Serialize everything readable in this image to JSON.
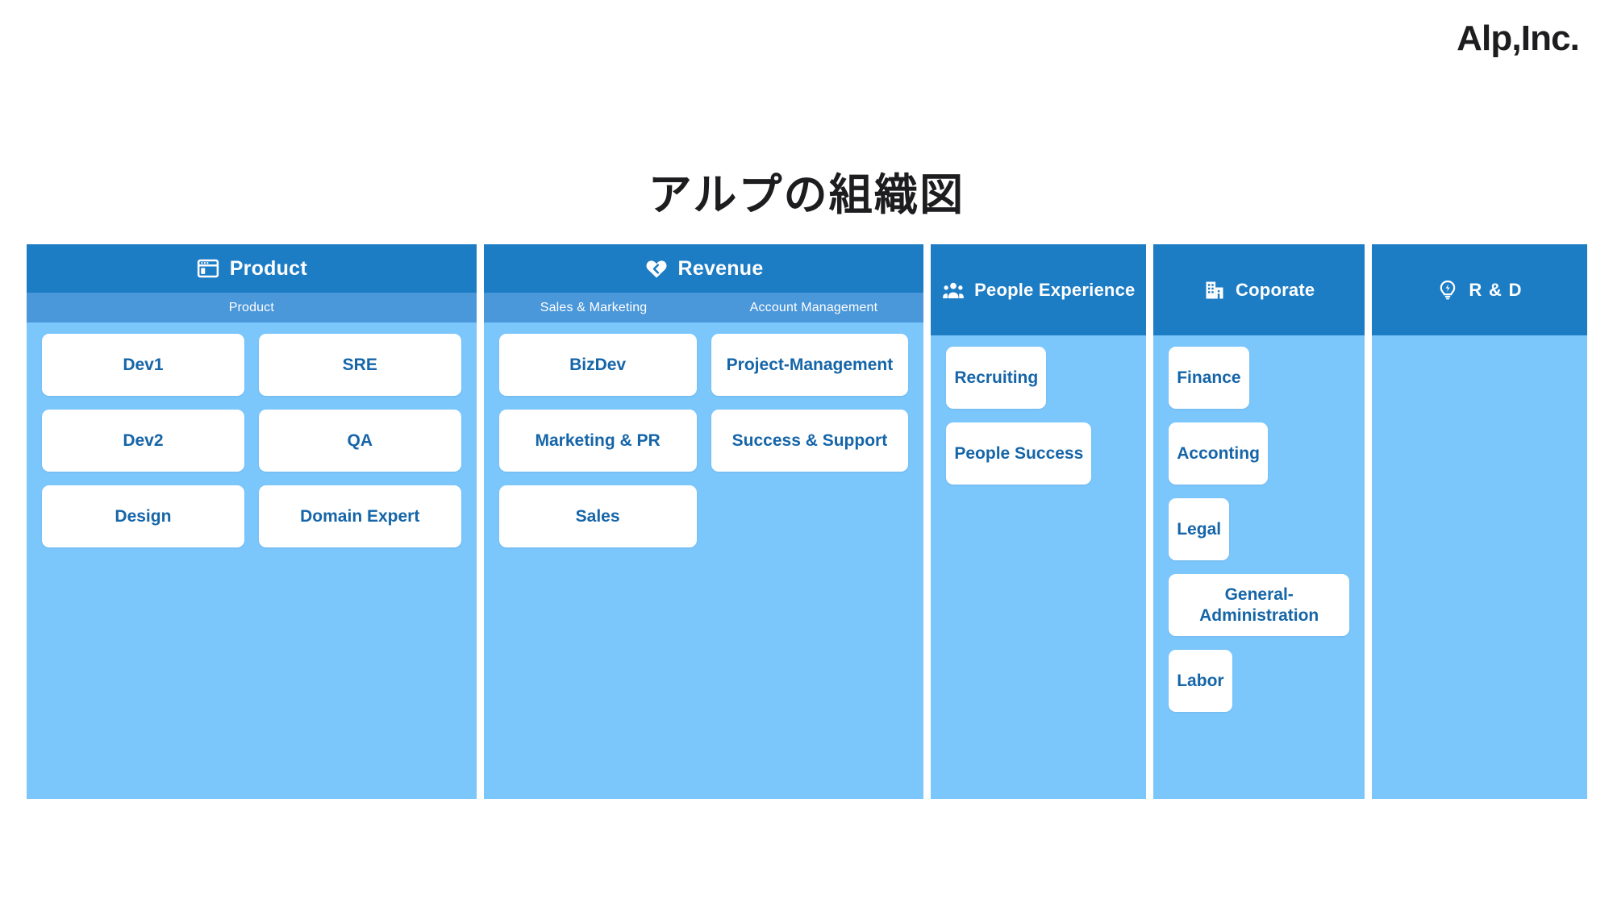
{
  "logo": {
    "text": "Alp,Inc."
  },
  "title": "アルプの組織図",
  "colors": {
    "header_blue": "#1C7CC4",
    "subband_blue": "#4A97DA",
    "body_blue": "#7BC6FB",
    "card_bg": "#FFFFFF",
    "card_text": "#1565A8",
    "page_bg": "#FFFFFF",
    "title_text": "#1D1D1F"
  },
  "chart_data": {
    "type": "table",
    "title": "アルプの組織図",
    "columns": [
      {
        "label": "Product",
        "icon": "browser-window-icon",
        "subgroups": [
          {
            "label": "Product",
            "teams": [
              "Dev1",
              "Dev2",
              "Design"
            ]
          },
          {
            "label": "",
            "teams": [
              "SRE",
              "QA",
              "Domain Expert"
            ]
          }
        ]
      },
      {
        "label": "Revenue",
        "icon": "heart-icon",
        "subgroups": [
          {
            "label": "Sales & Marketing",
            "teams": [
              "BizDev",
              "Marketing & PR",
              "Sales"
            ]
          },
          {
            "label": "Account Management",
            "teams": [
              "Project-Management",
              "Success & Support"
            ]
          }
        ]
      },
      {
        "label": "People Experience",
        "icon": "people-group-icon",
        "subgroups": [
          {
            "label": "",
            "teams": [
              "Recruiting",
              "People Success"
            ]
          }
        ]
      },
      {
        "label": "Coporate",
        "icon": "building-icon",
        "subgroups": [
          {
            "label": "",
            "teams": [
              "Finance",
              "Acconting",
              "Legal",
              "General-Administration",
              "Labor"
            ]
          }
        ]
      },
      {
        "label": "R & D",
        "icon": "lightbulb-bolt-icon",
        "subgroups": [
          {
            "label": "",
            "teams": []
          }
        ]
      }
    ]
  },
  "columns": {
    "product": {
      "header": "Product",
      "subband": {
        "left": "Product"
      },
      "cards": {
        "left": [
          "Dev1",
          "Dev2",
          "Design"
        ],
        "right": [
          "SRE",
          "QA",
          "Domain Expert"
        ]
      }
    },
    "revenue": {
      "header": "Revenue",
      "subband": {
        "left": "Sales & Marketing",
        "right": "Account Management"
      },
      "cards": {
        "left": [
          "BizDev",
          "Marketing & PR",
          "Sales"
        ],
        "right": [
          "Project-Management",
          "Success & Support"
        ]
      }
    },
    "people": {
      "header": "People Experience",
      "cards": [
        "Recruiting",
        "People Success"
      ]
    },
    "corporate": {
      "header": "Coporate",
      "cards": [
        "Finance",
        "Acconting",
        "Legal",
        "General-Administration",
        "Labor"
      ]
    },
    "rd": {
      "header": "R & D",
      "cards": []
    }
  }
}
